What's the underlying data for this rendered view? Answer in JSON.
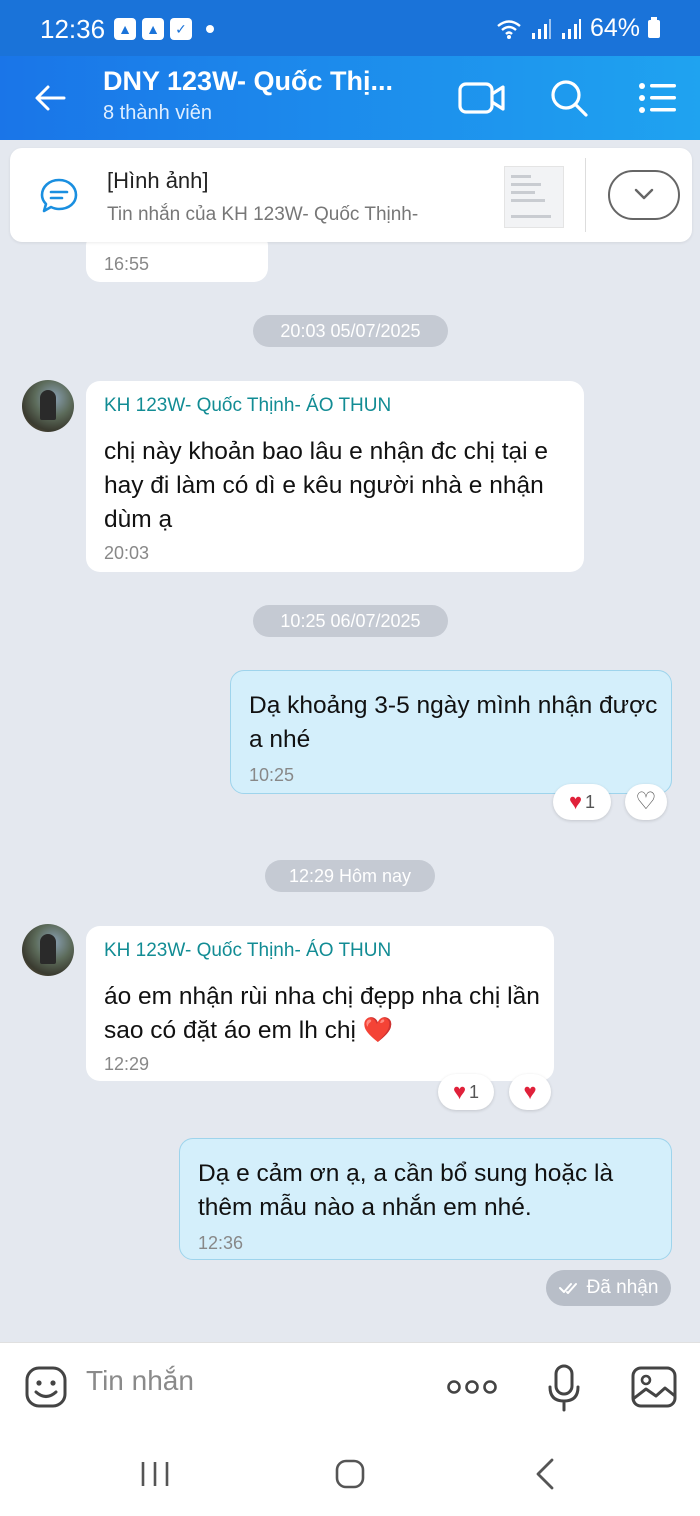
{
  "status": {
    "time": "12:36",
    "battery": "64%"
  },
  "header": {
    "title": "DNY 123W- Quốc Thị...",
    "subtitle": "8 thành viên"
  },
  "pinned": {
    "title": "[Hình ảnh]",
    "subtitle": "Tin nhắn của KH 123W- Quốc Thịnh-"
  },
  "prev_message": {
    "time": "16:55"
  },
  "messages": [
    {
      "date": "20:03 05/07/2025",
      "sender": "KH 123W- Quốc Thịnh- ÁO THUN",
      "text": "chị này khoản bao lâu e nhận đc chị tại e hay đi làm có dì e kêu người nhà e nhận dùm ạ",
      "time": "20:03"
    },
    {
      "date": "10:25 06/07/2025",
      "text": "Dạ khoảng 3-5 ngày mình nhận được a nhé",
      "time": "10:25",
      "reaction_count": "1"
    },
    {
      "date": "12:29 Hôm nay",
      "sender": "KH 123W- Quốc Thịnh- ÁO THUN",
      "text": "áo em nhận rùi nha chị đẹpp nha chị lần sao có đặt áo em lh chị ❤️",
      "time": "12:29",
      "reaction_count": "1"
    },
    {
      "text": "Dạ e cảm ơn ạ, a cần bổ sung hoặc là thêm mẫu nào a nhắn em nhé.",
      "time": "12:36"
    }
  ],
  "delivery_status": "Đã nhận",
  "input": {
    "placeholder": "Tin nhắn"
  },
  "colors": {
    "header_start": "#1a75e8",
    "header_end": "#1fa3f0",
    "sender_name": "#128c94",
    "outgoing_bubble": "#d4effb",
    "heart": "#e0213a"
  },
  "icons": [
    "back-arrow-icon",
    "video-call-icon",
    "search-icon",
    "menu-list-icon",
    "chat-bubble-icon",
    "chevron-down-icon",
    "heart-icon",
    "heart-outline-icon",
    "double-check-icon",
    "sticker-icon",
    "more-icon",
    "mic-icon",
    "image-icon",
    "recents-icon",
    "home-icon",
    "back-icon"
  ]
}
